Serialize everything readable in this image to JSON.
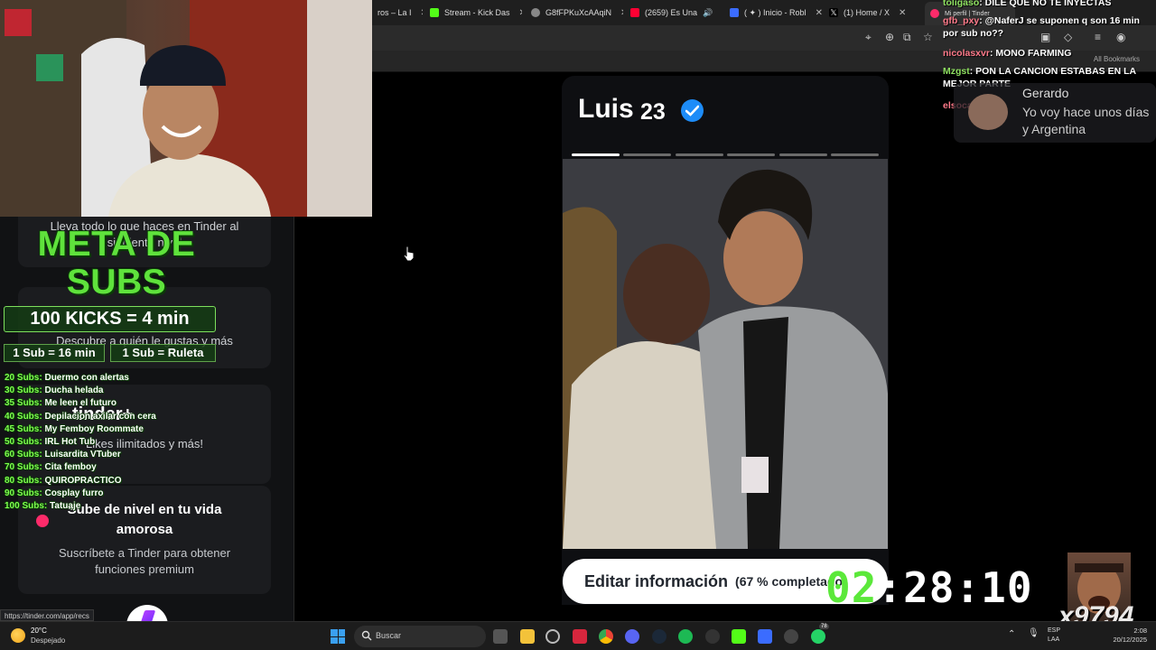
{
  "browser": {
    "tabs": [
      {
        "label": "ros – La I",
        "color": "#d7263d"
      },
      {
        "label": "Stream - Kick Das",
        "color": "#53fc18"
      },
      {
        "label": "G8fFPKuXcAAqiN",
        "color": "#888888"
      },
      {
        "label": "(2659) Es Una",
        "color": "#ff0033"
      },
      {
        "label": "( ✦ ) Inicio - Robl",
        "color": "#3b6cff"
      },
      {
        "label": "(1) Home / X",
        "color": "#ffffff"
      },
      {
        "label": "Mi perfil | Tinder",
        "color": "#fd2b6a"
      }
    ],
    "all_bookmarks": "All Bookmarks",
    "status_url": "https://tinder.com/app/recs"
  },
  "left_panel": {
    "card1_text": "Lleva todo lo que haces en Tinder al siguiente nivel",
    "card2_text": "Descubre a quién le gustas y más",
    "card3_logo": "tinder+",
    "card3_text": "Likes ilimitados y más!",
    "premium_title": "Sube de nivel en tu vida amorosa",
    "premium_subtitle": "Suscríbete a Tinder para obtener funciones premium"
  },
  "profile": {
    "name": "Luis",
    "age": "23",
    "photo_bars": 6,
    "active_bar": 0,
    "edit_label": "Editar información",
    "edit_progress": "(67 % completado)"
  },
  "overlay": {
    "meta_title": "META DE SUBS",
    "kicks_rule": "100 KICKS = 4 min",
    "sub_rule_1": "1 Sub = 16 min",
    "sub_rule_2": "1 Sub = Ruleta",
    "goals": [
      {
        "count": "20 Subs:",
        "goal": "Duermo con alertas"
      },
      {
        "count": "30 Subs:",
        "goal": "Ducha helada"
      },
      {
        "count": "35 Subs:",
        "goal": "Me leen el futuro"
      },
      {
        "count": "40 Subs:",
        "goal": "Depilacion axilar con cera"
      },
      {
        "count": "45 Subs:",
        "goal": "My Femboy Roommate"
      },
      {
        "count": "50 Subs:",
        "goal": "IRL Hot Tub"
      },
      {
        "count": "60 Subs:",
        "goal": "Luisardita VTuber"
      },
      {
        "count": "70 Subs:",
        "goal": "Cita femboy"
      },
      {
        "count": "80 Subs:",
        "goal": "QUIROPRACTICO"
      },
      {
        "count": "90 Subs:",
        "goal": "Cosplay furro"
      },
      {
        "count": "100 Subs:",
        "goal": "Tatuaje"
      }
    ],
    "timer_a": "02",
    "timer_b": ":28:10",
    "watermark": "x9794"
  },
  "chat": {
    "messages": [
      {
        "user": "toligaso",
        "text": ": DILE QUE NO TE INYECTAS"
      },
      {
        "user": "gfb_pxy",
        "text": ": @NaferJ se suponen q son 16 min por sub no??"
      },
      {
        "user": "nicolasxvr",
        "text": ": MONO FARMING"
      },
      {
        "user": "Mzgst",
        "text": ": PON LA CANCION ESTABAS EN LA MEJOR PARTE"
      },
      {
        "user": "elsocarapapa",
        "text": ":"
      }
    ],
    "toast_name": "Gerardo",
    "toast_message": "Yo voy hace unos días y Argentina"
  },
  "taskbar": {
    "temperature": "20°C",
    "weather": "Despejado",
    "search_placeholder": "Buscar",
    "lang_1": "ESP",
    "lang_2": "LAA",
    "time": "2:08",
    "date": "20/12/2025",
    "badge_count": "78"
  },
  "colors": {
    "tinder_pink": "#fd2b6a",
    "verified_blue": "#1d8cf8",
    "overlay_green": "#5fe23c"
  }
}
